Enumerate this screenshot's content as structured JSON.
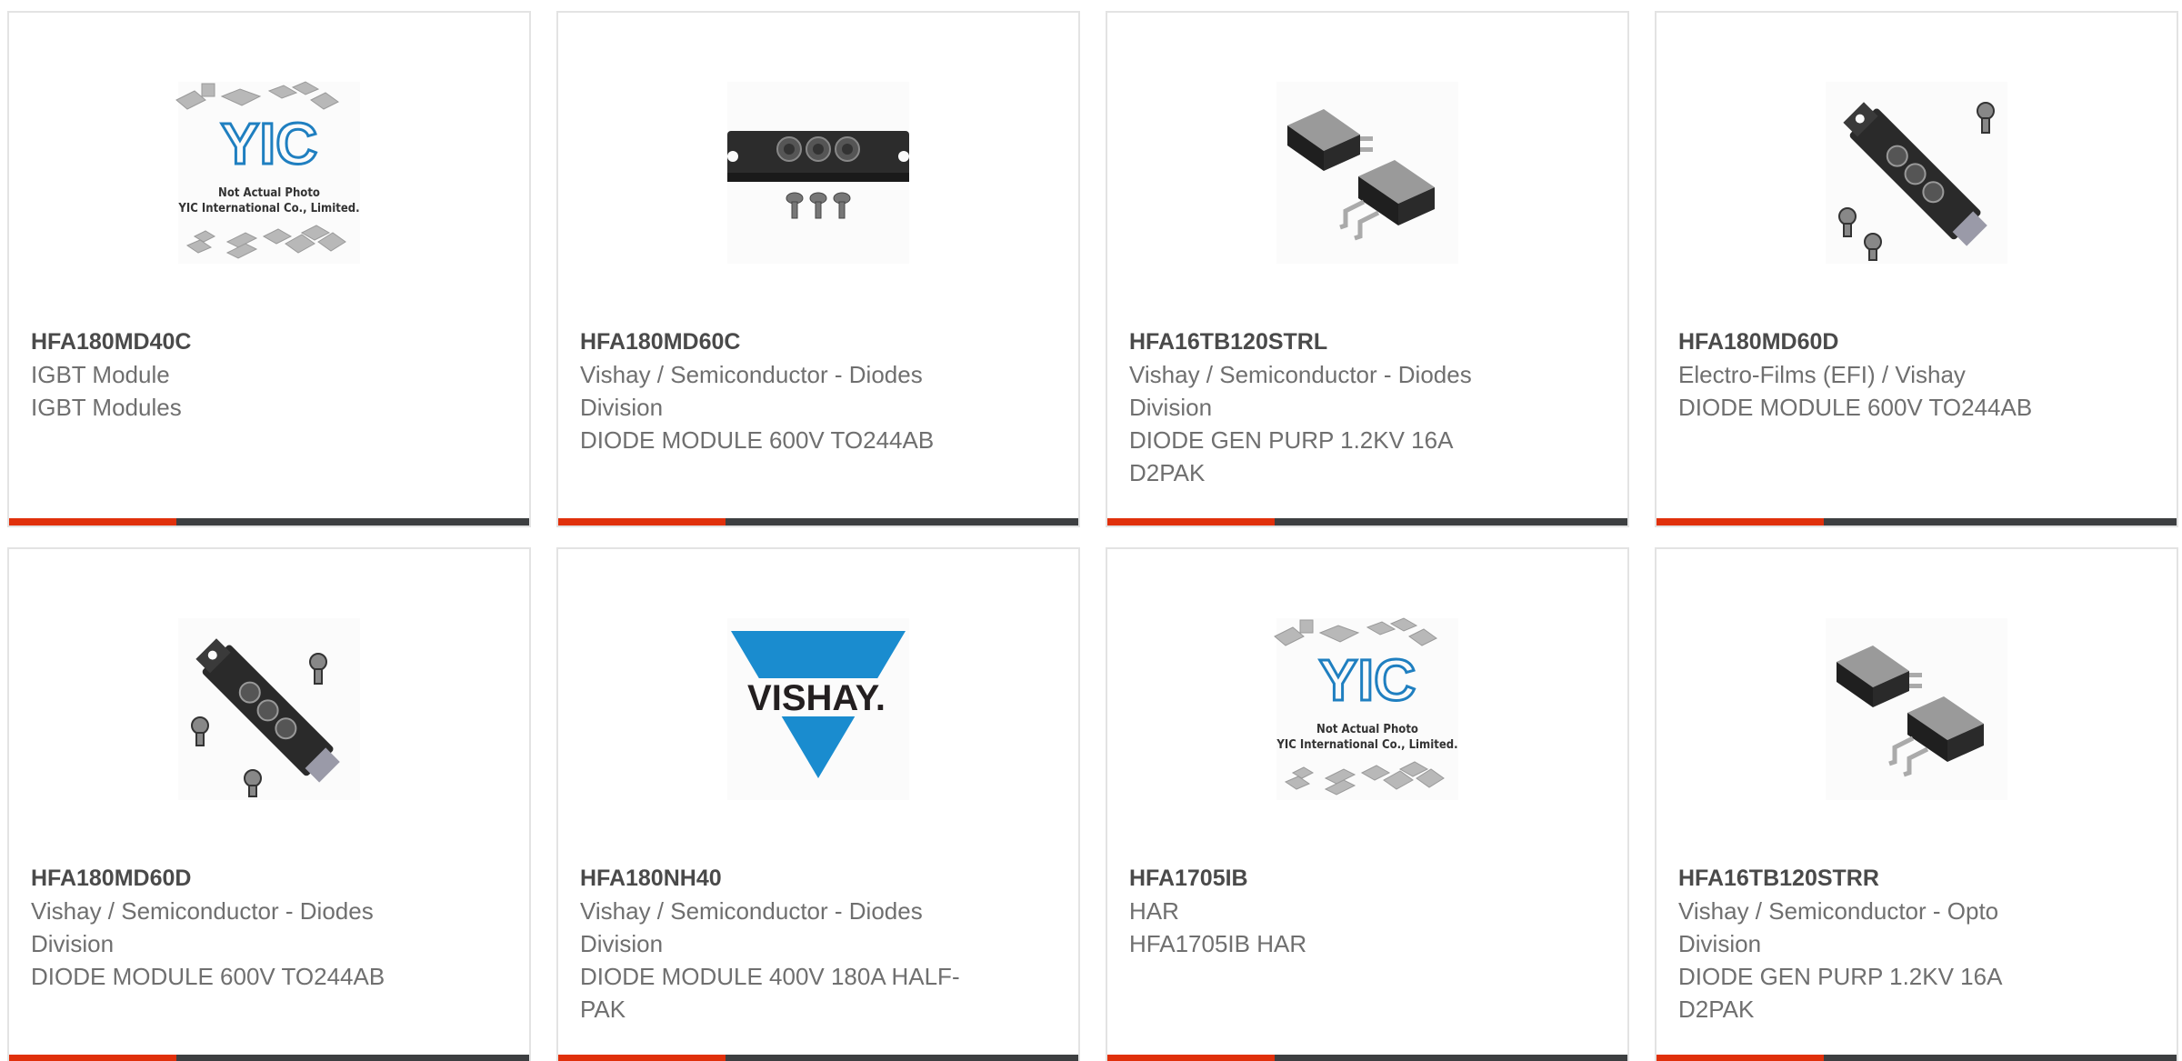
{
  "products": [
    {
      "part_number": "HFA180MD40C",
      "manufacturer": "IGBT Module",
      "description": "IGBT Modules",
      "image": "yic-not-actual-photo"
    },
    {
      "part_number": "HFA180MD60C",
      "manufacturer": "Vishay / Semiconductor - Diodes Division",
      "description": "DIODE MODULE 600V TO244AB",
      "image": "diode-module-horizontal"
    },
    {
      "part_number": "HFA16TB120STRL",
      "manufacturer": "Vishay / Semiconductor - Diodes Division",
      "description": "DIODE GEN PURP 1.2KV 16A D2PAK",
      "image": "d2pak-package"
    },
    {
      "part_number": "HFA180MD60D",
      "manufacturer": "Electro-Films (EFI) / Vishay",
      "description": "DIODE MODULE 600V TO244AB",
      "image": "diode-module-diagonal"
    },
    {
      "part_number": "HFA180MD60D",
      "manufacturer": "Vishay / Semiconductor - Diodes Division",
      "description": "DIODE MODULE 600V TO244AB",
      "image": "diode-module-diagonal"
    },
    {
      "part_number": "HFA180NH40",
      "manufacturer": "Vishay / Semiconductor - Diodes Division",
      "description": "DIODE MODULE 400V 180A HALF-PAK",
      "image": "vishay-logo"
    },
    {
      "part_number": "HFA1705IB",
      "manufacturer": "HAR",
      "description": "HFA1705IB HAR",
      "image": "yic-not-actual-photo"
    },
    {
      "part_number": "HFA16TB120STRR",
      "manufacturer": "Vishay / Semiconductor - Opto Division",
      "description": "DIODE GEN PURP 1.2KV 16A D2PAK",
      "image": "d2pak-package"
    }
  ],
  "yic": {
    "line1": "Not Actual Photo",
    "line2": "YIC International Co., Limited.",
    "logo": "YIC"
  },
  "vishay": {
    "logo": "VISHAY."
  },
  "colors": {
    "accent": "#e0300b",
    "bar": "#3d3f41",
    "border": "#e3e3e3",
    "yic_blue": "#1f7fc0",
    "vishay_blue": "#1a8ccf"
  }
}
